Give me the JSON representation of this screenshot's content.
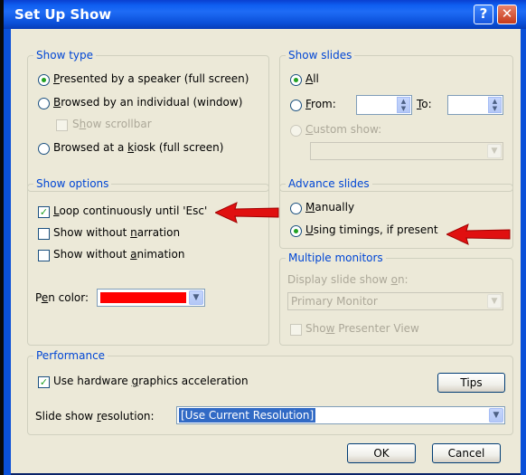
{
  "window": {
    "title": "Set Up Show",
    "help_glyph": "?",
    "close_glyph": "✕"
  },
  "show_type": {
    "legend": "Show type",
    "presented": {
      "label_pre": "",
      "label_u": "P",
      "label_post": "resented by a speaker (full screen)",
      "selected": true
    },
    "browsed_individual": {
      "label_pre": "",
      "label_u": "B",
      "label_post": "rowsed by an individual (window)",
      "selected": false
    },
    "show_scrollbar": {
      "label_pre": "S",
      "label_u": "h",
      "label_post": "ow scrollbar",
      "checked": false,
      "enabled": false
    },
    "browsed_kiosk": {
      "label_pre": "Browsed at a ",
      "label_u": "k",
      "label_post": "iosk (full screen)",
      "selected": false
    }
  },
  "show_slides": {
    "legend": "Show slides",
    "all": {
      "label_pre": "",
      "label_u": "A",
      "label_post": "ll",
      "selected": true
    },
    "from": {
      "label_pre": "",
      "label_u": "F",
      "label_post": "rom:",
      "value": "",
      "selected": false
    },
    "to": {
      "label_pre": "",
      "label_u": "T",
      "label_post": "o:",
      "value": ""
    },
    "custom": {
      "label_pre": "",
      "label_u": "C",
      "label_post": "ustom show:",
      "enabled": false,
      "value": ""
    }
  },
  "show_options": {
    "legend": "Show options",
    "loop": {
      "label_pre": "",
      "label_u": "L",
      "label_post": "oop continuously until 'Esc'",
      "checked": true
    },
    "no_narration": {
      "label_pre": "Show without ",
      "label_u": "n",
      "label_post": "arration",
      "checked": false
    },
    "no_animation": {
      "label_pre": "Show without ",
      "label_u": "a",
      "label_post": "nimation",
      "checked": false
    },
    "pen_color": {
      "label_pre": "P",
      "label_u": "e",
      "label_post": "n color:",
      "color": "#ff0000"
    }
  },
  "advance_slides": {
    "legend": "Advance slides",
    "manually": {
      "label_pre": "",
      "label_u": "M",
      "label_post": "anually",
      "selected": false
    },
    "timings": {
      "label_pre": "",
      "label_u": "U",
      "label_post": "sing timings, if present",
      "selected": true
    }
  },
  "monitors": {
    "legend": "Multiple monitors",
    "display_label_pre": "Display slide show ",
    "display_label_u": "o",
    "display_label_post": "n:",
    "display_value": "Primary Monitor",
    "presenter": {
      "label_pre": "Sho",
      "label_u": "w",
      "label_post": " Presenter View",
      "checked": false,
      "enabled": false
    }
  },
  "performance": {
    "legend": "Performance",
    "hw_accel": {
      "label_pre": "Use hardware ",
      "label_u": "g",
      "label_post": "raphics acceleration",
      "checked": true
    },
    "tips_label": "Tips",
    "resolution_label_pre": "Slide show ",
    "resolution_label_u": "r",
    "resolution_label_post": "esolution:",
    "resolution_value": "[Use Current Resolution]"
  },
  "buttons": {
    "ok": "OK",
    "cancel": "Cancel"
  },
  "colors": {
    "accent": "#0046d5",
    "annotation_arrow": "#e01010",
    "title_bar": "#0a5af0"
  }
}
